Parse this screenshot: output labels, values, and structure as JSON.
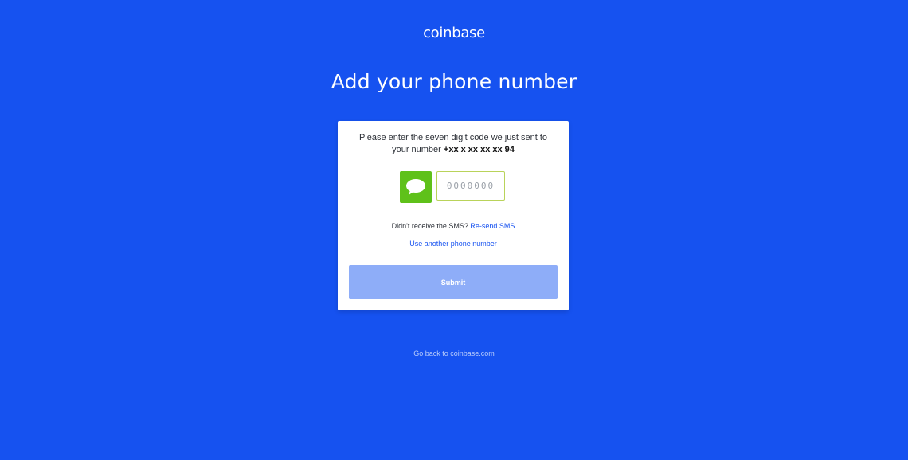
{
  "brand": {
    "logo_text": "coinbase"
  },
  "page": {
    "title": "Add your phone number"
  },
  "card": {
    "instructions_text": "Please enter the seven digit code we just sent to your number",
    "phone_number": "+xx x xx xx xx 94",
    "sms_icon": "chat-bubble-icon",
    "code_input": {
      "value": "",
      "placeholder": "0000000"
    },
    "resend_prompt": "Didn't receive the SMS?",
    "resend_link": "Re-send SMS",
    "another_number_link": "Use another phone number",
    "submit_label": "Submit"
  },
  "footer": {
    "back_link": "Go back to coinbase.com"
  },
  "colors": {
    "background": "#1652f0",
    "sms_green": "#5fc11a",
    "submit_disabled": "#8eadf8",
    "link": "#1652f0"
  }
}
